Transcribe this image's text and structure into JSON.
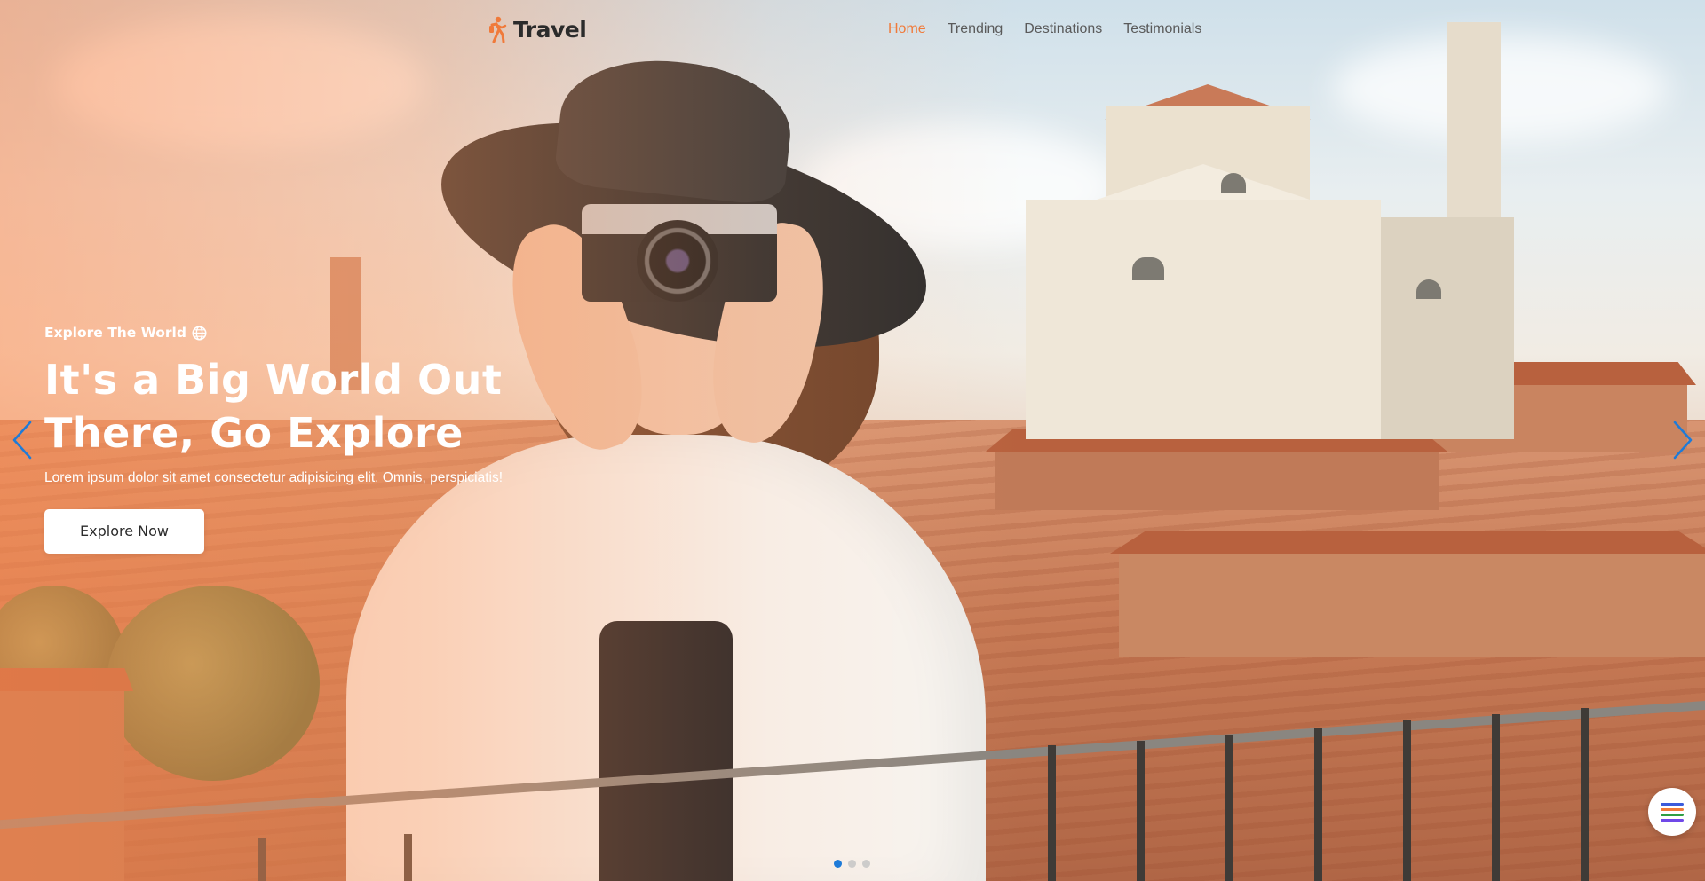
{
  "brand": {
    "name": "Travel",
    "icon": "hiker-icon",
    "icon_color": "#f07a3a"
  },
  "nav": {
    "items": [
      {
        "label": "Home",
        "active": true
      },
      {
        "label": "Trending",
        "active": false
      },
      {
        "label": "Destinations",
        "active": false
      },
      {
        "label": "Testimonials",
        "active": false
      }
    ],
    "active_color": "#f07a3a"
  },
  "hero": {
    "eyebrow": "Explore The World",
    "eyebrow_icon": "globe-icon",
    "headline_line1": "It's a Big World Out",
    "headline_line2": "There, Go Explore",
    "subtitle": "Lorem ipsum dolor sit amet consectetur adipisicing elit. Omnis, perspiciatis!",
    "cta_label": "Explore Now"
  },
  "slider": {
    "prev_icon": "chevron-left-icon",
    "next_icon": "chevron-right-icon",
    "arrow_color": "#1e7bd8",
    "slide_count": 3,
    "active_slide": 1
  },
  "menu_button": {
    "icon": "hamburger-menu-icon",
    "line_colors": [
      "#3b5bdb",
      "#f07a3a",
      "#2f9e44",
      "#7048e8"
    ]
  }
}
